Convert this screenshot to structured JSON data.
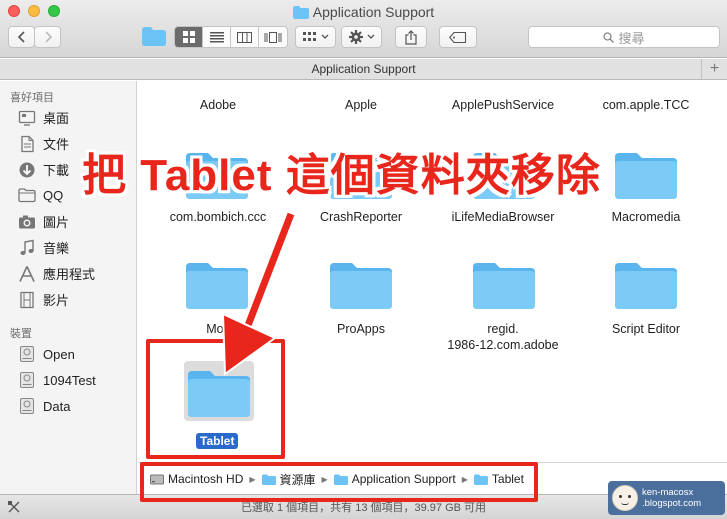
{
  "window": {
    "title": "Application Support"
  },
  "toolbar": {
    "search_placeholder": "搜尋"
  },
  "tab": {
    "label": "Application Support",
    "add_label": "+"
  },
  "sidebar": {
    "favorites_header": "喜好項目",
    "favorites": [
      {
        "label": "桌面",
        "icon": "desktop-icon"
      },
      {
        "label": "文件",
        "icon": "document-icon"
      },
      {
        "label": "下載",
        "icon": "download-icon"
      },
      {
        "label": "QQ",
        "icon": "folder-icon"
      },
      {
        "label": "圖片",
        "icon": "camera-icon"
      },
      {
        "label": "音樂",
        "icon": "music-icon"
      },
      {
        "label": "應用程式",
        "icon": "apps-icon"
      },
      {
        "label": "影片",
        "icon": "film-icon"
      }
    ],
    "devices_header": "裝置",
    "devices": [
      {
        "label": "Open",
        "icon": "disk-icon"
      },
      {
        "label": "1094Test",
        "icon": "disk-icon"
      },
      {
        "label": "Data",
        "icon": "disk-icon"
      }
    ]
  },
  "files": {
    "row1": [
      "Adobe",
      "Apple",
      "ApplePushService",
      "com.apple.TCC"
    ],
    "row2": [
      "com.bombich.ccc",
      "CrashReporter",
      "iLifeMediaBrowser",
      "Macromedia"
    ],
    "row3": [
      "Moz",
      "ProApps",
      "regid.",
      "Script Editor"
    ],
    "row3_line2": "1986-12.com.adobe",
    "selected": "Tablet"
  },
  "path": [
    "Macintosh HD",
    "資源庫",
    "Application Support",
    "Tablet"
  ],
  "status": "已選取 1 個項目，共有 13 個項目，39.97 GB 可用",
  "annotation": {
    "headline": "把 Tablet 這個資料夾移除",
    "accent": "#e8261c"
  },
  "watermark": {
    "line1": "ken-macosx",
    "line2": ".blogspot.com"
  },
  "colors": {
    "folder": "#6cc3f5",
    "selection": "#2a6ad0"
  }
}
